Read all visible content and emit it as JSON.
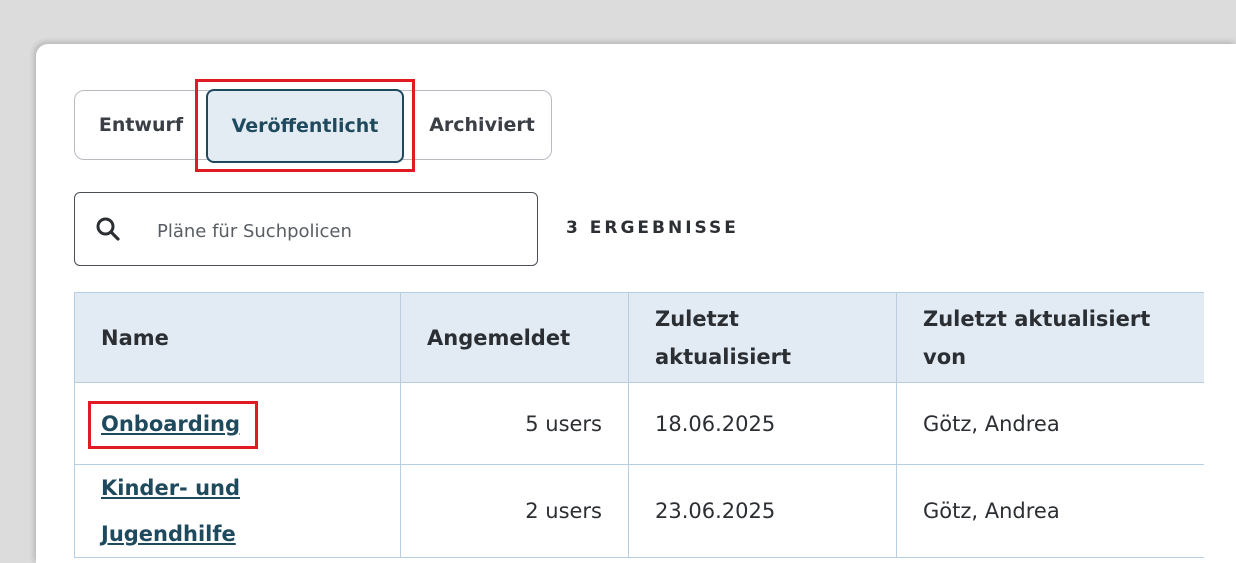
{
  "tabs": {
    "entwurf": "Entwurf",
    "veroeffentlicht": "Veröffentlicht",
    "archiviert": "Archiviert",
    "active": "veroeffentlicht"
  },
  "search": {
    "placeholder": "Pläne für Suchpolicen",
    "value": ""
  },
  "results_label": "3 ERGEBNISSE",
  "table": {
    "headers": {
      "name": "Name",
      "angemeldet": "Angemeldet",
      "zuletzt_aktualisiert": "Zuletzt aktualisiert",
      "zuletzt_aktualisiert_von": "Zuletzt aktualisiert von"
    },
    "rows": [
      {
        "name": "Onboarding",
        "angemeldet": "5 users",
        "date": "18.06.2025",
        "von": "Götz, Andrea"
      },
      {
        "name": "Kinder- und Jugendhilfe",
        "angemeldet": "2 users",
        "date": "23.06.2025",
        "von": "Götz, Andrea"
      }
    ]
  },
  "colors": {
    "accent": "#1f4a5e",
    "highlight": "#e01b24",
    "header_bg": "#e2ebf3",
    "border": "#b7cde0"
  }
}
